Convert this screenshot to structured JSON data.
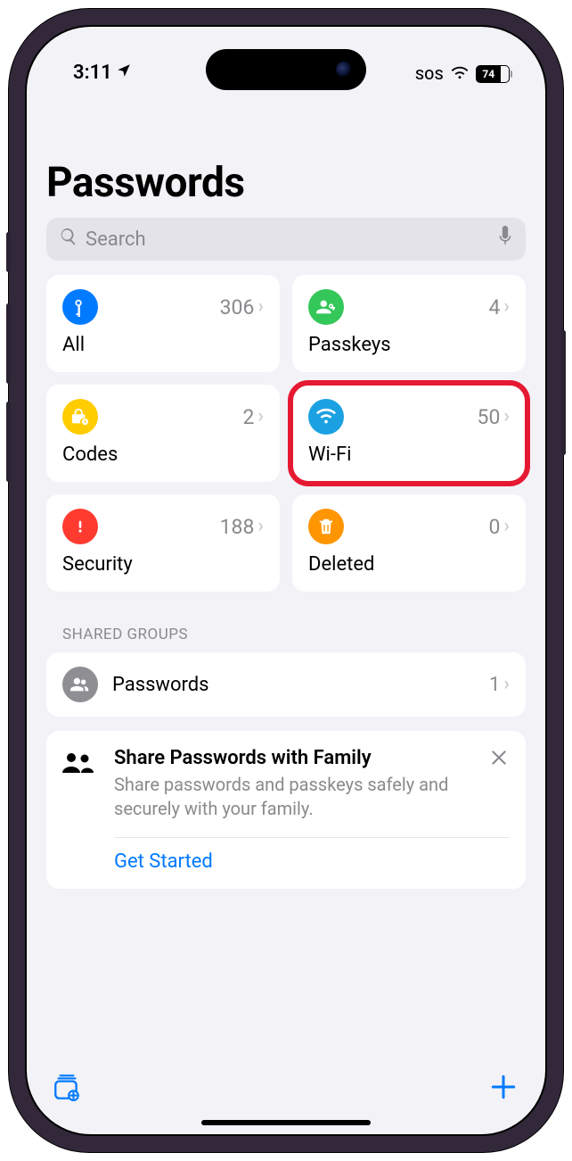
{
  "status": {
    "time": "3:11",
    "sos": "SOS",
    "battery_pct": "74"
  },
  "header": {
    "title": "Passwords"
  },
  "search": {
    "placeholder": "Search"
  },
  "cards": {
    "all": {
      "label": "All",
      "count": "306",
      "color": "#007aff"
    },
    "passkeys": {
      "label": "Passkeys",
      "count": "4",
      "color": "#34c759"
    },
    "codes": {
      "label": "Codes",
      "count": "2",
      "color": "#ffcc00"
    },
    "wifi": {
      "label": "Wi-Fi",
      "count": "50",
      "color": "#1ba1e2"
    },
    "security": {
      "label": "Security",
      "count": "188",
      "color": "#ff3b30"
    },
    "deleted": {
      "label": "Deleted",
      "count": "0",
      "color": "#ff9500"
    }
  },
  "shared_groups": {
    "header": "SHARED GROUPS",
    "items": [
      {
        "label": "Passwords",
        "count": "1"
      }
    ]
  },
  "share_prompt": {
    "title": "Share Passwords with Family",
    "desc": "Share passwords and passkeys safely and securely with your family.",
    "action": "Get Started"
  }
}
